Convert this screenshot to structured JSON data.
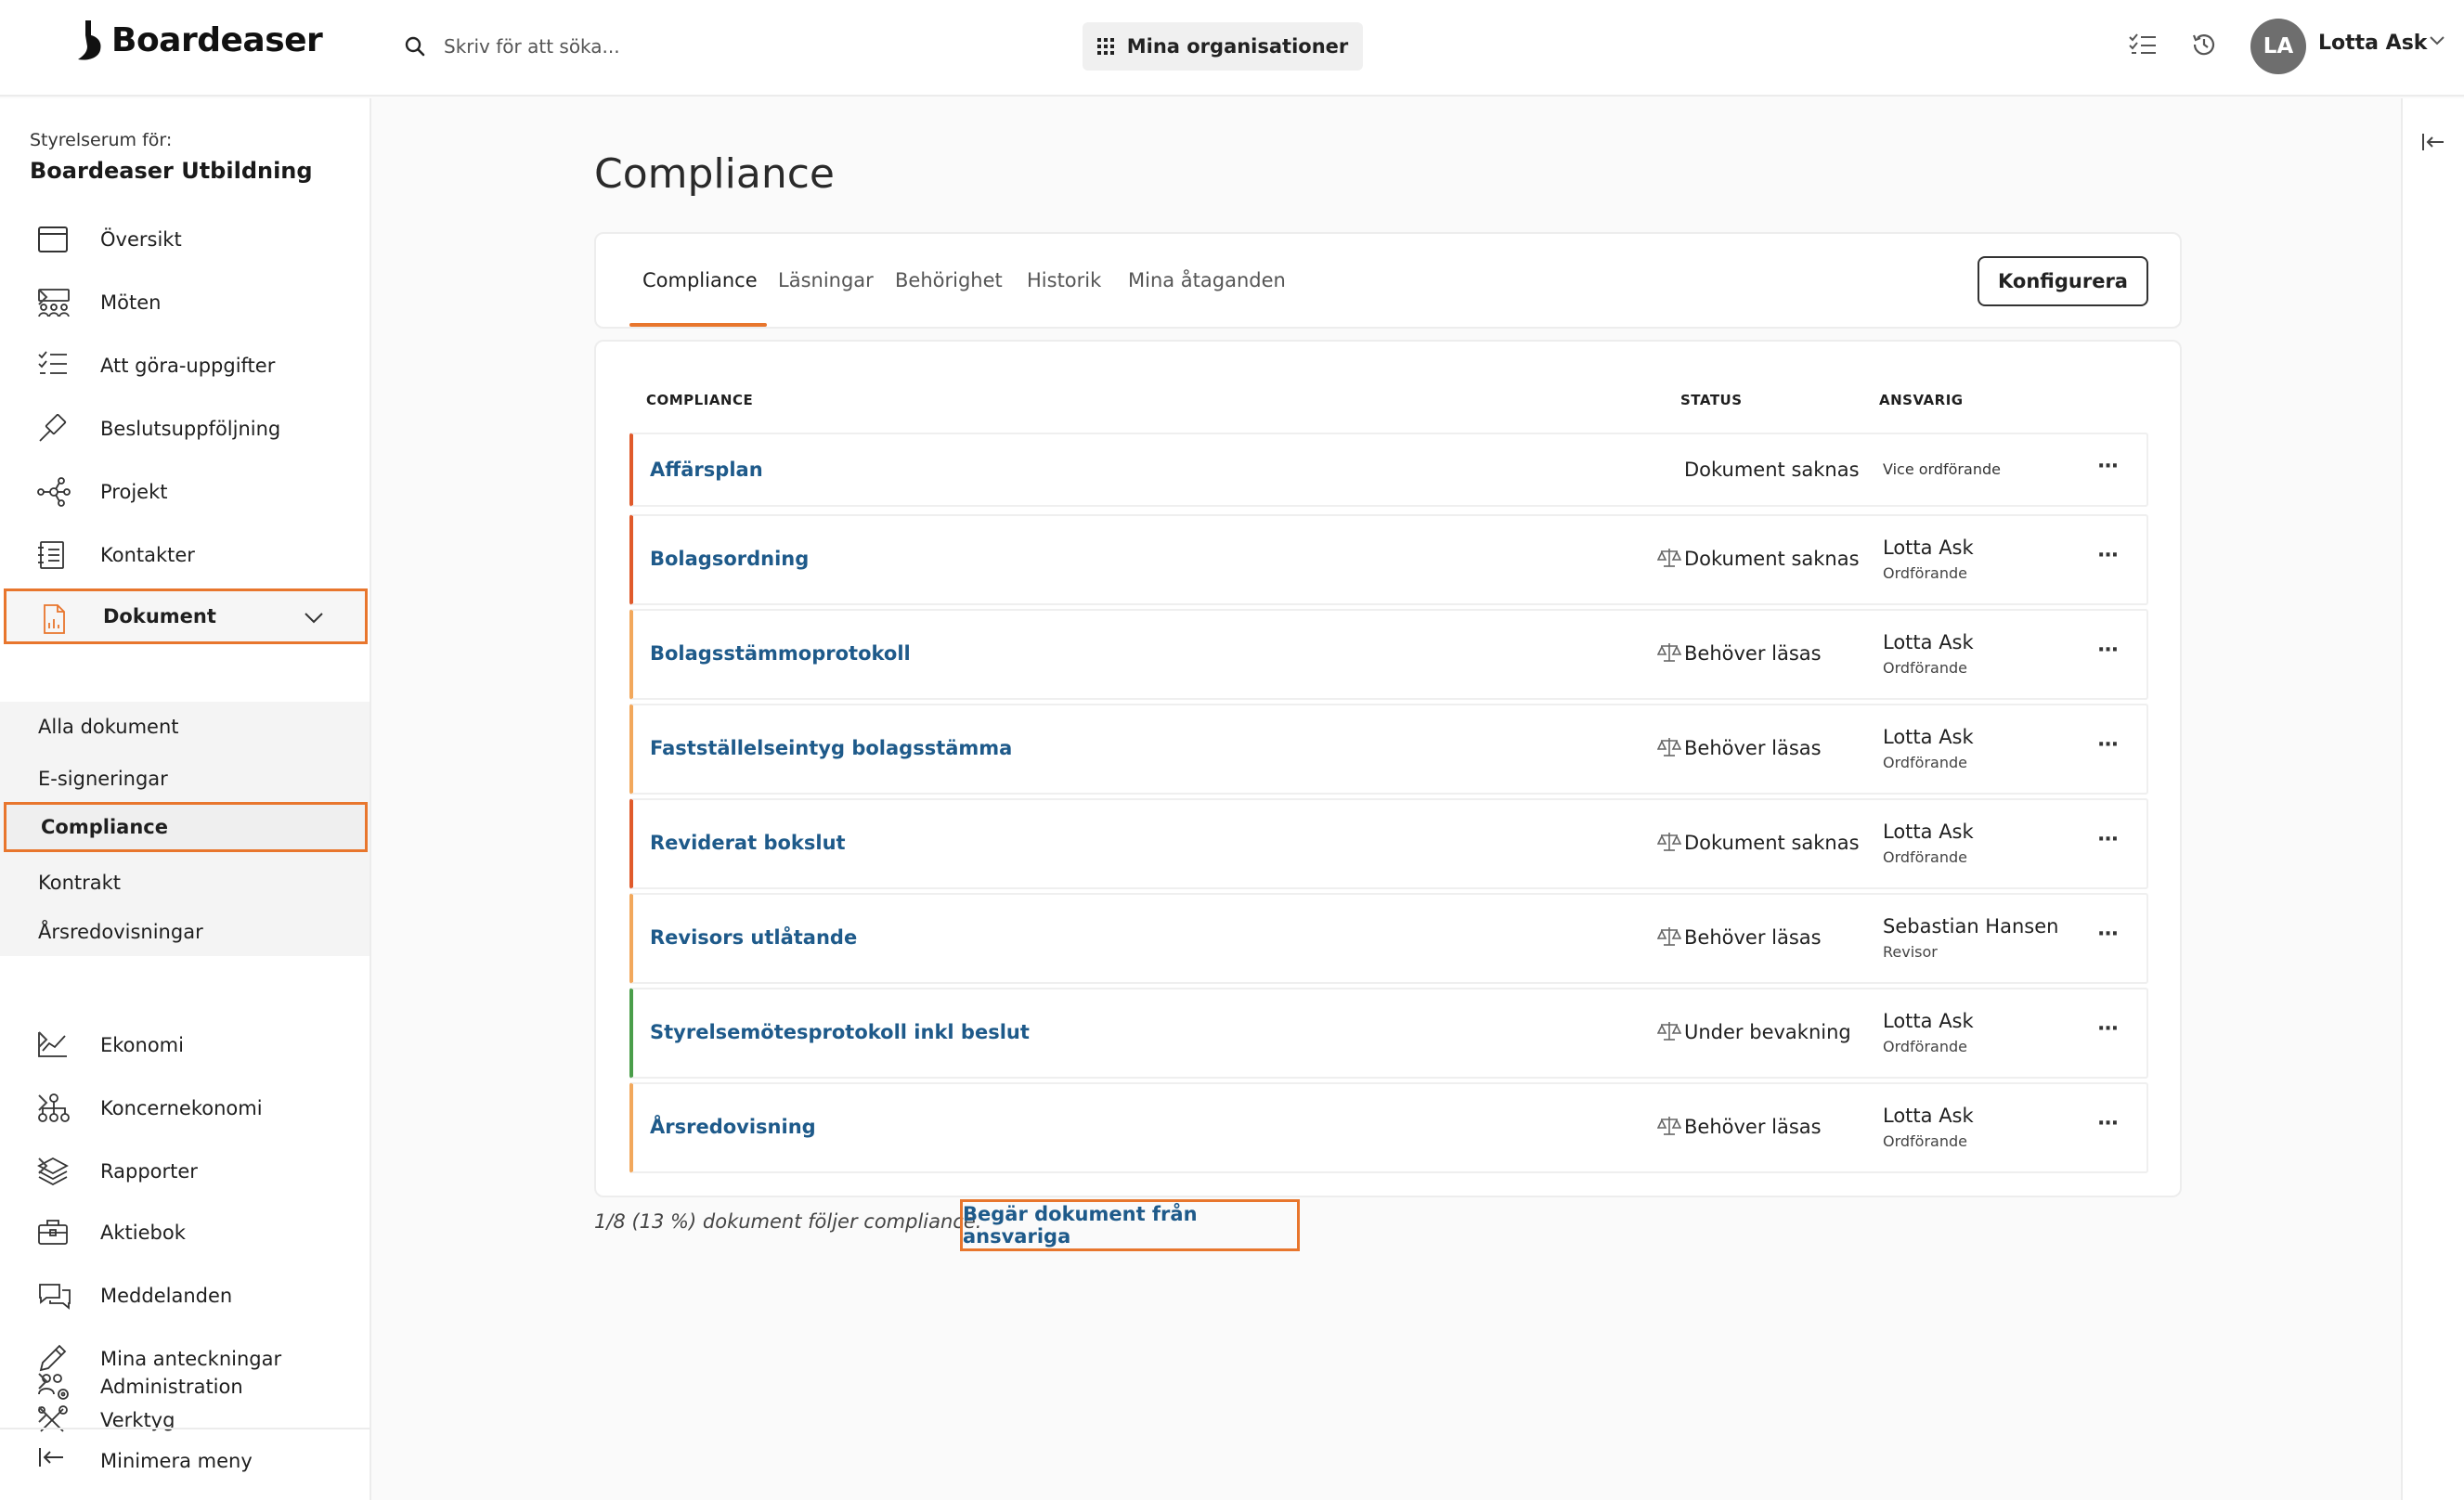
{
  "app": {
    "name": "Boardeaser"
  },
  "search": {
    "placeholder": "Skriv för att söka..."
  },
  "header": {
    "org_button": "Mina organisationer",
    "user": {
      "initials": "LA",
      "name": "Lotta Ask"
    }
  },
  "sidebar": {
    "board_label": "Styrelserum för:",
    "board_name": "Boardeaser Utbildning",
    "items": [
      {
        "label": "Översikt",
        "icon": "calendar-icon"
      },
      {
        "label": "Möten",
        "icon": "meeting-icon"
      },
      {
        "label": "Att göra-uppgifter",
        "icon": "checklist-icon"
      },
      {
        "label": "Beslutsuppföljning",
        "icon": "gavel-icon"
      },
      {
        "label": "Projekt",
        "icon": "network-icon"
      },
      {
        "label": "Kontakter",
        "icon": "contacts-icon"
      },
      {
        "label": "Dokument",
        "icon": "document-icon"
      },
      {
        "label": "Ekonomi",
        "icon": "chart-icon"
      },
      {
        "label": "Koncernekonomi",
        "icon": "org-chart-icon"
      },
      {
        "label": "Rapporter",
        "icon": "layers-icon"
      },
      {
        "label": "Aktiebok",
        "icon": "briefcase-icon"
      },
      {
        "label": "Meddelanden",
        "icon": "chat-icon"
      },
      {
        "label": "Mina anteckningar",
        "icon": "pen-icon"
      },
      {
        "label": "Verktyg",
        "icon": "tools-icon"
      },
      {
        "label": "Administration",
        "icon": "users-gear-icon"
      }
    ],
    "sub_items": [
      "Alla dokument",
      "E-signeringar",
      "Compliance",
      "Kontrakt",
      "Årsredovisningar"
    ],
    "minimize": "Minimera meny"
  },
  "main": {
    "title": "Compliance",
    "tabs": [
      "Compliance",
      "Läsningar",
      "Behörighet",
      "Historik",
      "Mina åtaganden"
    ],
    "configure": "Konfigurera",
    "table": {
      "headers": {
        "name": "COMPLIANCE",
        "status": "STATUS",
        "responsible": "ANSVARIG"
      },
      "rows": [
        {
          "name": "Affärsplan",
          "status": "Dokument saknas",
          "responsible": "Vice ordförande",
          "role": "",
          "color": "#e05a2b"
        },
        {
          "name": "Bolagsordning",
          "status": "Dokument saknas",
          "responsible": "Lotta Ask",
          "role": "Ordförande",
          "color": "#e05a2b"
        },
        {
          "name": "Bolagsstämmoprotokoll",
          "status": "Behöver läsas",
          "responsible": "Lotta Ask",
          "role": "Ordförande",
          "color": "#f2a85c"
        },
        {
          "name": "Fastställelseintyg bolagsstämma",
          "status": "Behöver läsas",
          "responsible": "Lotta Ask",
          "role": "Ordförande",
          "color": "#f2a85c"
        },
        {
          "name": "Reviderat bokslut",
          "status": "Dokument saknas",
          "responsible": "Lotta Ask",
          "role": "Ordförande",
          "color": "#e05a2b"
        },
        {
          "name": "Revisors utlåtande",
          "status": "Behöver läsas",
          "responsible": "Sebastian Hansen",
          "role": "Revisor",
          "color": "#f2a85c"
        },
        {
          "name": "Styrelsemötesprotokoll inkl beslut",
          "status": "Under bevakning",
          "responsible": "Lotta Ask",
          "role": "Ordförande",
          "color": "#4a9e4a"
        },
        {
          "name": "Årsredovisning",
          "status": "Behöver läsas",
          "responsible": "Lotta Ask",
          "role": "Ordförande",
          "color": "#f2a85c"
        }
      ],
      "more_glyph": "···"
    },
    "footer_text": "1/8 (13 %) dokument följer compliance.",
    "request_button": "Begär dokument från ansvariga"
  },
  "colors": {
    "accent": "#e8762d",
    "link": "#1e5a8a",
    "missing": "#e05a2b",
    "needs_read": "#f2a85c",
    "watched": "#4a9e4a"
  }
}
